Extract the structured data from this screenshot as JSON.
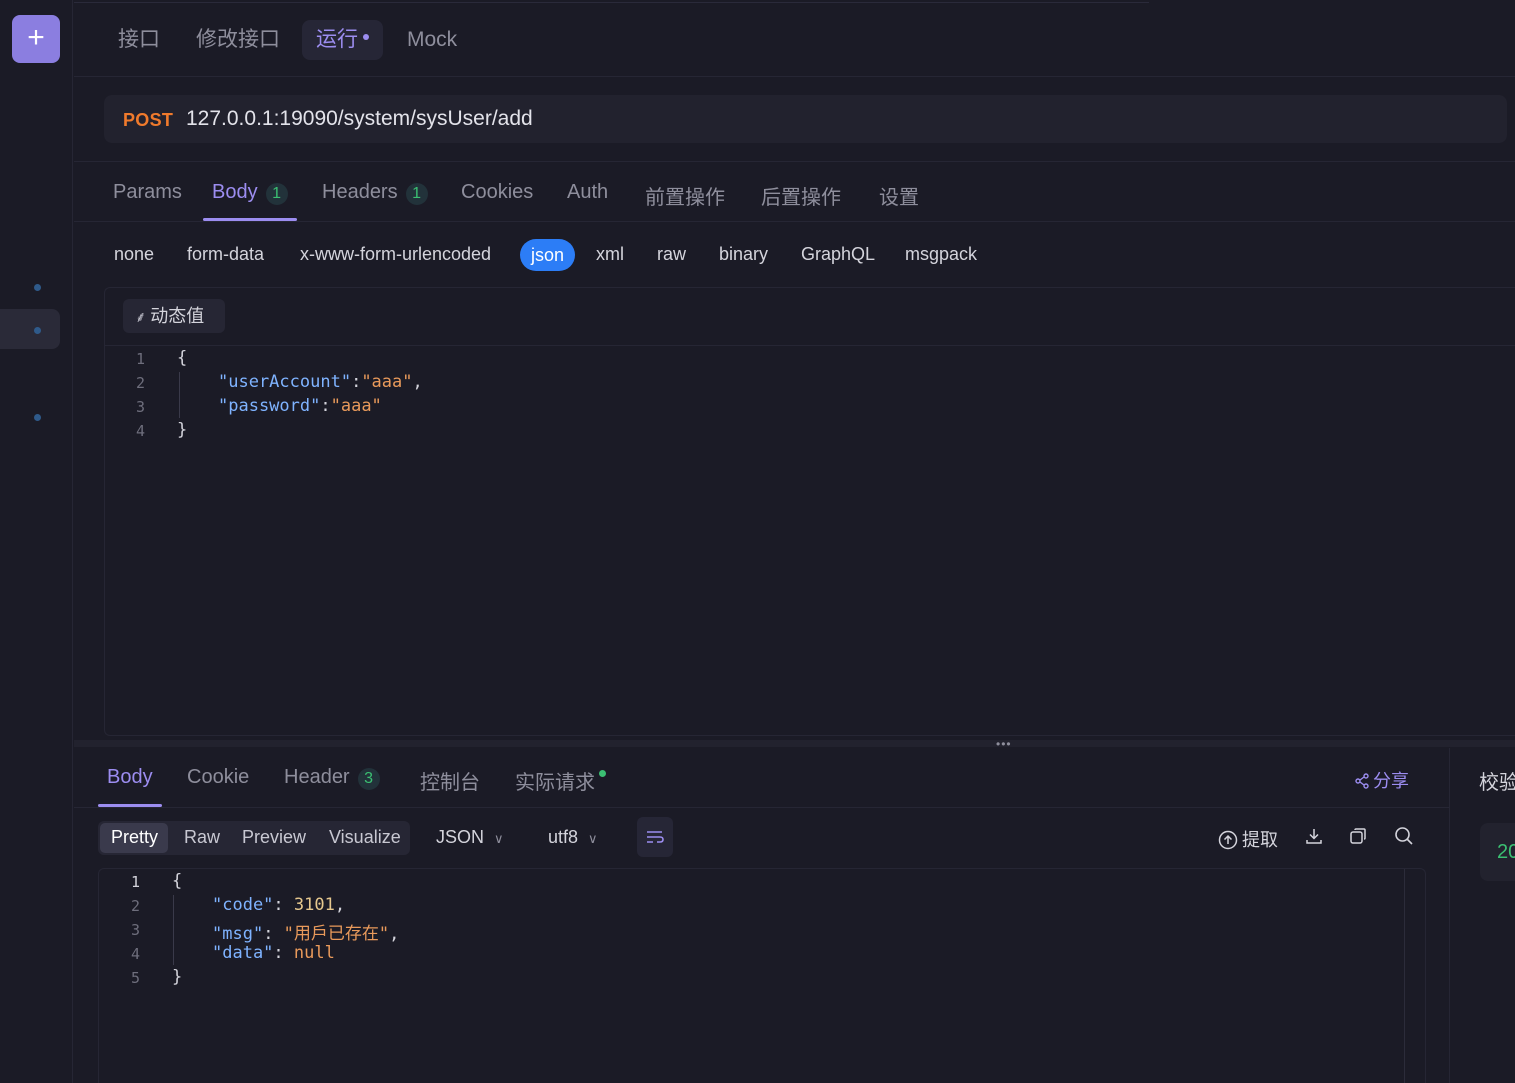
{
  "sidebar": {
    "add_label": "+"
  },
  "top_tabs": [
    {
      "label": "接口"
    },
    {
      "label": "修改接口"
    },
    {
      "label": "运行"
    },
    {
      "label": "Mock"
    }
  ],
  "request": {
    "method": "POST",
    "url": "127.0.0.1:19090/system/sysUser/add"
  },
  "request_tabs": {
    "params": "Params",
    "body": "Body",
    "body_count": "1",
    "headers": "Headers",
    "headers_count": "1",
    "cookies": "Cookies",
    "auth": "Auth",
    "pre": "前置操作",
    "post": "后置操作",
    "settings": "设置"
  },
  "body_types": [
    "none",
    "form-data",
    "x-www-form-urlencoded",
    "json",
    "xml",
    "raw",
    "binary",
    "GraphQL",
    "msgpack"
  ],
  "dynamic_value_label": "动态值",
  "request_body": {
    "line_numbers": [
      "1",
      "2",
      "3",
      "4"
    ],
    "open": "{",
    "key1": "\"userAccount\"",
    "val1": "\"aaa\"",
    "key2": "\"password\"",
    "val2": "\"aaa\"",
    "close": "}"
  },
  "response_tabs": {
    "body": "Body",
    "cookie": "Cookie",
    "header": "Header",
    "header_count": "3",
    "console": "控制台",
    "actual_request": "实际请求",
    "share": "分享"
  },
  "right_panel": {
    "title": "校验",
    "value": "20"
  },
  "response_toolbar": {
    "pretty": "Pretty",
    "raw": "Raw",
    "preview": "Preview",
    "visualize": "Visualize",
    "format": "JSON",
    "encoding": "utf8",
    "extract": "提取"
  },
  "response_body": {
    "line_numbers": [
      "1",
      "2",
      "3",
      "4",
      "5"
    ],
    "open": "{",
    "key_code": "\"code\"",
    "val_code": "3101",
    "key_msg": "\"msg\"",
    "val_msg": "\"用戶已存在\"",
    "key_data": "\"data\"",
    "val_data": "null",
    "close": "}"
  },
  "colors": {
    "accent": "#9c8df0",
    "method": "#f07a2c",
    "json_active": "#2c7df6",
    "success": "#3bbf72"
  }
}
